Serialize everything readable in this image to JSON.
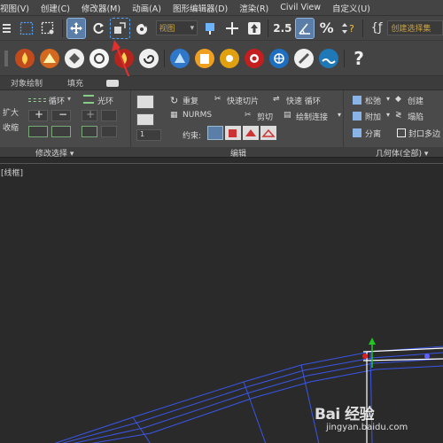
{
  "menu": [
    "视图(V)",
    "创建(C)",
    "修改器(M)",
    "动画(A)",
    "图形编辑器(D)",
    "渲染(R)",
    "Civil View",
    "自定义(U)"
  ],
  "toolbar": {
    "view_dropdown": "视图",
    "selection_set": "创建选择集",
    "snap_label": "2.5"
  },
  "ribbon_tabs": [
    "对象绘制",
    "填充"
  ],
  "ribbon": {
    "expand": "扩大",
    "shrink": "收缩",
    "loop": "循环",
    "ring": "光环",
    "modify_selection": "修改选择 ▾",
    "repeat": "重复",
    "quick_slice": "快速切片",
    "quick_loop": "快速 循环",
    "nurms": "NURMS",
    "cut": "剪切",
    "paint_connect": "绘制连接",
    "constrain": "约束:",
    "spinner_value": "1",
    "edit": "编辑",
    "relax": "松弛",
    "create": "创建",
    "attach": "附加",
    "collapse": "塌陷",
    "detach": "分离",
    "cap_poly": "封口多边",
    "geometry_all": "几何体(全部) ▾"
  },
  "viewport": {
    "label": "[线框]"
  },
  "watermark": {
    "brand": "Bai 经验",
    "url": "jingyan.baidu.com"
  },
  "colors": {
    "active_tool": "#5a7ea8",
    "annotation_arrow": "#e03030",
    "wire_blue": "#3a56e8",
    "axis_green": "#1ec81e",
    "axis_red": "#e02020"
  }
}
